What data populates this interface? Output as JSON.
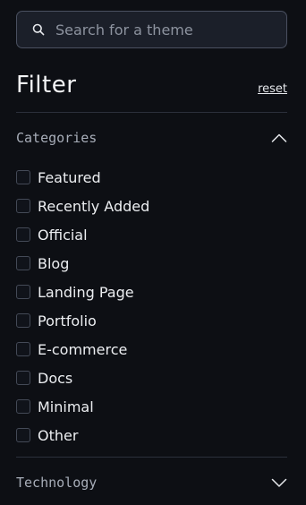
{
  "search": {
    "placeholder": "Search for a theme",
    "value": ""
  },
  "filter": {
    "title": "Filter",
    "reset_label": "reset"
  },
  "sections": [
    {
      "title": "Categories",
      "expanded": true,
      "items": [
        {
          "label": "Featured",
          "checked": false
        },
        {
          "label": "Recently Added",
          "checked": false
        },
        {
          "label": "Official",
          "checked": false
        },
        {
          "label": "Blog",
          "checked": false
        },
        {
          "label": "Landing Page",
          "checked": false
        },
        {
          "label": "Portfolio",
          "checked": false
        },
        {
          "label": "E-commerce",
          "checked": false
        },
        {
          "label": "Docs",
          "checked": false
        },
        {
          "label": "Minimal",
          "checked": false
        },
        {
          "label": "Other",
          "checked": false
        }
      ]
    },
    {
      "title": "Technology",
      "expanded": false
    }
  ],
  "icons": {
    "search": "search-icon",
    "collapse": "chevron-up-icon",
    "expand": "chevron-down-icon"
  },
  "colors": {
    "background": "#0d0f14",
    "input_bg": "#1b1f29",
    "input_border": "#4a5060",
    "divider": "#2b303b"
  }
}
